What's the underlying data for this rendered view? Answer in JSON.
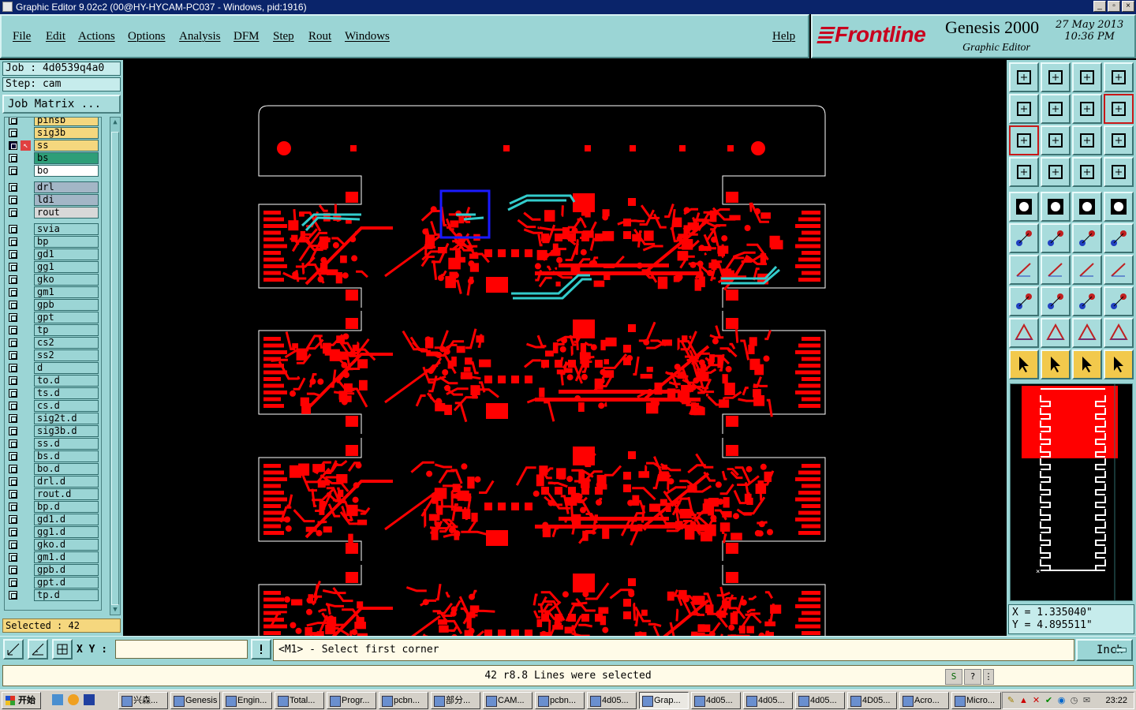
{
  "window": {
    "title": "Graphic Editor 9.02c2 (00@HY-HYCAM-PC037 - Windows, pid:1916)"
  },
  "menu": {
    "file": "File",
    "edit": "Edit",
    "actions": "Actions",
    "options": "Options",
    "analysis": "Analysis",
    "dfm": "DFM",
    "step": "Step",
    "rout": "Rout",
    "windows": "Windows",
    "help": "Help"
  },
  "brand": {
    "logo": "Frontline",
    "product": "Genesis 2000",
    "subtitle": "Graphic Editor",
    "date": "27 May 2013",
    "time": "10:36 PM"
  },
  "job": {
    "job_line": "Job : 4d0539q4a0",
    "step_line": "Step: cam",
    "matrix_button": "Job Matrix ..."
  },
  "layers": [
    {
      "name": "pinsb",
      "color": "#f5d77e",
      "affected": false,
      "partial": true
    },
    {
      "name": "sig3b",
      "color": "#f5d77e",
      "affected": false
    },
    {
      "name": "ss",
      "color": "#f5d77e",
      "affected": true,
      "work": true
    },
    {
      "name": "bs",
      "color": "#2e9e78",
      "affected": false
    },
    {
      "name": "bo",
      "color": "#ffffff",
      "affected": false
    },
    {
      "name": "drl",
      "color": "#a3b6c6",
      "affected": false,
      "gap": true
    },
    {
      "name": "ldi",
      "color": "#a3b6c6",
      "affected": false
    },
    {
      "name": "rout",
      "color": "#d8d8d8",
      "affected": false
    },
    {
      "name": "svia",
      "color": "#9bd5d5",
      "affected": false,
      "gap": true
    },
    {
      "name": "bp",
      "color": "#9bd5d5",
      "affected": false
    },
    {
      "name": "gd1",
      "color": "#9bd5d5",
      "affected": false
    },
    {
      "name": "gg1",
      "color": "#9bd5d5",
      "affected": false
    },
    {
      "name": "gko",
      "color": "#9bd5d5",
      "affected": false
    },
    {
      "name": "gm1",
      "color": "#9bd5d5",
      "affected": false
    },
    {
      "name": "gpb",
      "color": "#9bd5d5",
      "affected": false
    },
    {
      "name": "gpt",
      "color": "#9bd5d5",
      "affected": false
    },
    {
      "name": "tp",
      "color": "#9bd5d5",
      "affected": false
    },
    {
      "name": "cs2",
      "color": "#9bd5d5",
      "affected": false
    },
    {
      "name": "ss2",
      "color": "#9bd5d5",
      "affected": false
    },
    {
      "name": "d",
      "color": "#9bd5d5",
      "affected": false
    },
    {
      "name": "to.d",
      "color": "#9bd5d5",
      "affected": false
    },
    {
      "name": "ts.d",
      "color": "#9bd5d5",
      "affected": false
    },
    {
      "name": "cs.d",
      "color": "#9bd5d5",
      "affected": false
    },
    {
      "name": "sig2t.d",
      "color": "#9bd5d5",
      "affected": false
    },
    {
      "name": "sig3b.d",
      "color": "#9bd5d5",
      "affected": false
    },
    {
      "name": "ss.d",
      "color": "#9bd5d5",
      "affected": false
    },
    {
      "name": "bs.d",
      "color": "#9bd5d5",
      "affected": false
    },
    {
      "name": "bo.d",
      "color": "#9bd5d5",
      "affected": false
    },
    {
      "name": "drl.d",
      "color": "#9bd5d5",
      "affected": false
    },
    {
      "name": "rout.d",
      "color": "#9bd5d5",
      "affected": false
    },
    {
      "name": "bp.d",
      "color": "#9bd5d5",
      "affected": false
    },
    {
      "name": "gd1.d",
      "color": "#9bd5d5",
      "affected": false
    },
    {
      "name": "gg1.d",
      "color": "#9bd5d5",
      "affected": false
    },
    {
      "name": "gko.d",
      "color": "#9bd5d5",
      "affected": false
    },
    {
      "name": "gm1.d",
      "color": "#9bd5d5",
      "affected": false
    },
    {
      "name": "gpb.d",
      "color": "#9bd5d5",
      "affected": false
    },
    {
      "name": "gpt.d",
      "color": "#9bd5d5",
      "affected": false
    },
    {
      "name": "tp.d",
      "color": "#9bd5d5",
      "affected": false
    }
  ],
  "selected": "Selected : 42",
  "colors": {
    "panel": "#9bd5d5",
    "copper": "#ff0000",
    "highlight": "#33cccc",
    "select_box": "#1a1aff",
    "outline": "#ffffff"
  },
  "coords": {
    "x": "X = 1.335040\"",
    "y": "Y = 4.895511\""
  },
  "input": {
    "xy_label": "X Y :",
    "xy_value": "",
    "prompt": "<M1> - Select first corner",
    "units": "Inch"
  },
  "status": {
    "message": "42 r8.8 Lines were selected"
  },
  "taskbar": {
    "start": "开始",
    "tasks": [
      "兴森...",
      "Genesis",
      "Engin...",
      "Total...",
      "Progr...",
      "pcbn...",
      "部分...",
      "CAM...",
      "pcbn...",
      "4d05...",
      "Grap...",
      "4d05...",
      "4d05...",
      "4d05...",
      "4D05...",
      "Acro...",
      "Micro..."
    ],
    "active_task": "Grap...",
    "clock": "23:22"
  }
}
